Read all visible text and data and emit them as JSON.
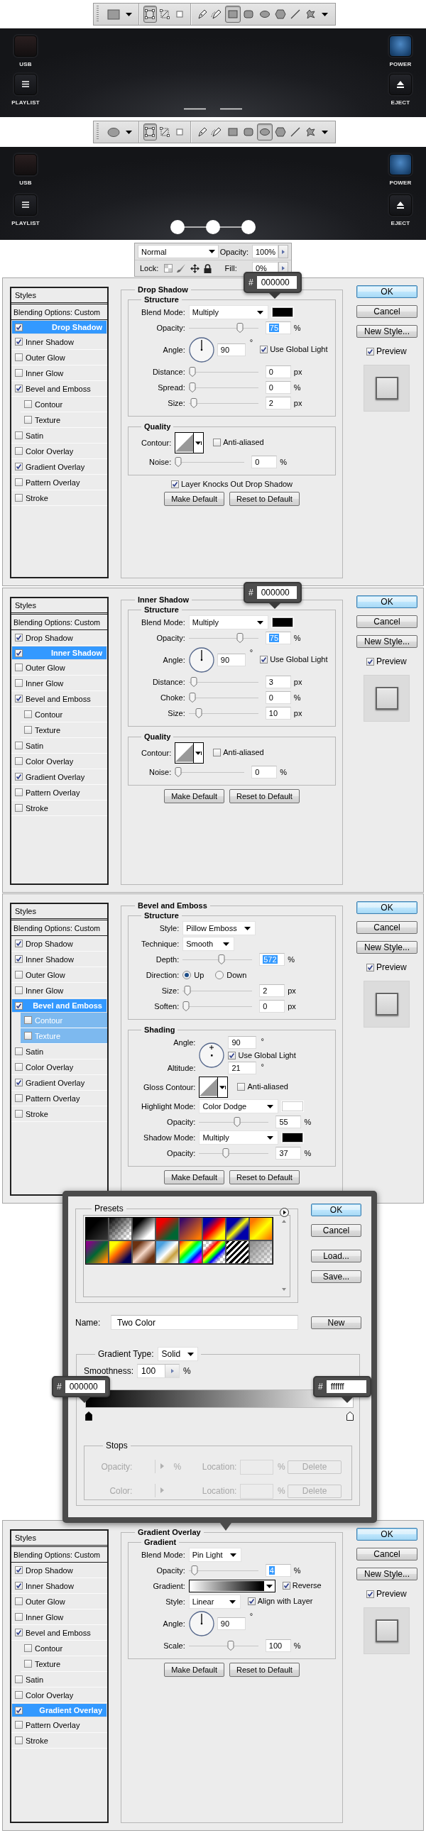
{
  "sections": [
    {
      "kind": "toolbar",
      "preset": {
        "kind": "rectangle"
      },
      "tools": [
        {
          "selected": true
        },
        {
          "selected": false
        },
        {
          "selected": false
        },
        {
          "selected": false
        },
        {
          "selected": false
        },
        {
          "selected": true
        },
        {
          "selected": false
        },
        {
          "selected": false
        },
        {
          "selected": false
        },
        {
          "selected": false
        },
        {
          "selected": false
        }
      ]
    },
    {
      "kind": "device_panel",
      "buttons": [
        {
          "kind": "usb",
          "label": "USB"
        },
        {
          "kind": "power",
          "label": "POWER"
        },
        {
          "kind": "playlist",
          "label": "PLAYLIST"
        },
        {
          "kind": "eject",
          "label": "EJECT"
        }
      ],
      "indicator": {
        "kind": "dashes"
      }
    },
    {
      "kind": "toolbar",
      "preset": {
        "kind": "ellipse"
      },
      "tools": [
        {
          "selected": true
        },
        {
          "selected": false
        },
        {
          "selected": false
        },
        {
          "selected": false
        },
        {
          "selected": false
        },
        {
          "selected": false
        },
        {
          "selected": false
        },
        {
          "selected": true
        },
        {
          "selected": false
        },
        {
          "selected": false
        },
        {
          "selected": false
        }
      ]
    },
    {
      "kind": "device_panel",
      "buttons": [
        {
          "kind": "usb",
          "label": "USB"
        },
        {
          "kind": "power",
          "label": "POWER"
        },
        {
          "kind": "playlist",
          "label": "PLAYLIST"
        },
        {
          "kind": "eject",
          "label": "EJECT"
        }
      ],
      "indicator": {
        "kind": "dots"
      }
    },
    {
      "kind": "layers_bar",
      "blend_mode": "Normal",
      "opacity_label": "Opacity:",
      "opacity": "100%",
      "lock_label": "Lock:",
      "fill_label": "Fill:",
      "fill": "0%"
    },
    {
      "kind": "layer_style",
      "panel_title": "Drop Shadow",
      "color_popup": {
        "prefix": "#",
        "value": "000000"
      },
      "styles_header": "Styles",
      "blending": "Blending Options: Custom",
      "styles": [
        {
          "label": "Drop Shadow",
          "checked": true,
          "selected": true
        },
        {
          "label": "Inner Shadow",
          "checked": true,
          "selected": false
        },
        {
          "label": "Outer Glow",
          "checked": false,
          "selected": false
        },
        {
          "label": "Inner Glow",
          "checked": false,
          "selected": false
        },
        {
          "label": "Bevel and Emboss",
          "checked": true,
          "selected": false,
          "children": [
            {
              "label": "Contour",
              "checked": false,
              "selected": false
            },
            {
              "label": "Texture",
              "checked": false,
              "selected": false
            }
          ]
        },
        {
          "label": "Satin",
          "checked": false,
          "selected": false
        },
        {
          "label": "Color Overlay",
          "checked": false,
          "selected": false
        },
        {
          "label": "Gradient Overlay",
          "checked": true,
          "selected": false
        },
        {
          "label": "Pattern Overlay",
          "checked": false,
          "selected": false
        },
        {
          "label": "Stroke",
          "checked": false,
          "selected": false
        }
      ],
      "groups": [
        {
          "title": "Structure",
          "rows": [
            {
              "kind": "select",
              "label": "Blend Mode:",
              "value": "Multiply",
              "color": "#000000"
            },
            {
              "kind": "slider",
              "label": "Opacity:",
              "level": 0.76,
              "value": "75",
              "unit": "%",
              "selected": true
            },
            {
              "kind": "angle",
              "label": "Angle:",
              "value": "90",
              "unit": "°",
              "check": {
                "label": "Use Global Light",
                "checked": true
              }
            },
            {
              "kind": "slider",
              "label": "Distance:",
              "level": 0,
              "value": "0",
              "unit": "px",
              "selected": false
            },
            {
              "kind": "slider",
              "label": "Spread:",
              "level": 0,
              "value": "0",
              "unit": "%",
              "selected": false
            },
            {
              "kind": "slider",
              "label": "Size:",
              "level": 0.02,
              "value": "2",
              "unit": "px",
              "selected": false
            }
          ]
        },
        {
          "title": "Quality",
          "rows": [
            {
              "kind": "contour",
              "label": "Contour:",
              "check": {
                "label": "Anti-aliased",
                "checked": false
              }
            },
            {
              "kind": "slider",
              "label": "Noise:",
              "level": 0,
              "value": "0",
              "unit": "%",
              "selected": false
            }
          ]
        }
      ],
      "options": [
        {
          "label": "Layer Knocks Out Drop Shadow",
          "checked": true
        }
      ],
      "footer_buttons": [
        "Make Default",
        "Reset to Default"
      ],
      "side_buttons": [
        {
          "label": "OK",
          "default": true
        },
        {
          "label": "Cancel",
          "default": false
        },
        {
          "label": "New Style...",
          "default": false
        }
      ],
      "preview": {
        "label": "Preview",
        "checked": true
      }
    },
    {
      "kind": "layer_style",
      "panel_title": "Inner Shadow",
      "color_popup": {
        "prefix": "#",
        "value": "000000"
      },
      "styles_header": "Styles",
      "blending": "Blending Options: Custom",
      "styles": [
        {
          "label": "Drop Shadow",
          "checked": true,
          "selected": false
        },
        {
          "label": "Inner Shadow",
          "checked": true,
          "selected": true
        },
        {
          "label": "Outer Glow",
          "checked": false,
          "selected": false
        },
        {
          "label": "Inner Glow",
          "checked": false,
          "selected": false
        },
        {
          "label": "Bevel and Emboss",
          "checked": true,
          "selected": false,
          "children": [
            {
              "label": "Contour",
              "checked": false,
              "selected": false
            },
            {
              "label": "Texture",
              "checked": false,
              "selected": false
            }
          ]
        },
        {
          "label": "Satin",
          "checked": false,
          "selected": false
        },
        {
          "label": "Color Overlay",
          "checked": false,
          "selected": false
        },
        {
          "label": "Gradient Overlay",
          "checked": true,
          "selected": false
        },
        {
          "label": "Pattern Overlay",
          "checked": false,
          "selected": false
        },
        {
          "label": "Stroke",
          "checked": false,
          "selected": false
        }
      ],
      "groups": [
        {
          "title": "Structure",
          "rows": [
            {
              "kind": "select",
              "label": "Blend Mode:",
              "value": "Multiply",
              "color": "#000000"
            },
            {
              "kind": "slider",
              "label": "Opacity:",
              "level": 0.76,
              "value": "75",
              "unit": "%",
              "selected": true
            },
            {
              "kind": "angle",
              "label": "Angle:",
              "value": "90",
              "unit": "°",
              "check": {
                "label": "Use Global Light",
                "checked": true
              }
            },
            {
              "kind": "slider",
              "label": "Distance:",
              "level": 0.03,
              "value": "3",
              "unit": "px",
              "selected": false
            },
            {
              "kind": "slider",
              "label": "Choke:",
              "level": 0,
              "value": "0",
              "unit": "%",
              "selected": false
            },
            {
              "kind": "slider",
              "label": "Size:",
              "level": 0.1,
              "value": "10",
              "unit": "px",
              "selected": false
            }
          ]
        },
        {
          "title": "Quality",
          "rows": [
            {
              "kind": "contour",
              "label": "Contour:",
              "check": {
                "label": "Anti-aliased",
                "checked": false
              }
            },
            {
              "kind": "slider",
              "label": "Noise:",
              "level": 0,
              "value": "0",
              "unit": "%",
              "selected": false
            }
          ]
        }
      ],
      "footer_buttons": [
        "Make Default",
        "Reset to Default"
      ],
      "side_buttons": [
        {
          "label": "OK",
          "default": true
        },
        {
          "label": "Cancel",
          "default": false
        },
        {
          "label": "New Style...",
          "default": false
        }
      ],
      "preview": {
        "label": "Preview",
        "checked": true
      }
    },
    {
      "kind": "layer_style",
      "panel_title": "Bevel and Emboss",
      "styles_header": "Styles",
      "blending": "Blending Options: Custom",
      "styles": [
        {
          "label": "Drop Shadow",
          "checked": true,
          "selected": false
        },
        {
          "label": "Inner Shadow",
          "checked": true,
          "selected": false
        },
        {
          "label": "Outer Glow",
          "checked": false,
          "selected": false
        },
        {
          "label": "Inner Glow",
          "checked": false,
          "selected": false
        },
        {
          "label": "Bevel and Emboss",
          "checked": true,
          "selected": true,
          "children": [
            {
              "label": "Contour",
              "checked": false,
              "selected": true
            },
            {
              "label": "Texture",
              "checked": false,
              "selected": true
            }
          ]
        },
        {
          "label": "Satin",
          "checked": false,
          "selected": false
        },
        {
          "label": "Color Overlay",
          "checked": false,
          "selected": false
        },
        {
          "label": "Gradient Overlay",
          "checked": true,
          "selected": false
        },
        {
          "label": "Pattern Overlay",
          "checked": false,
          "selected": false
        },
        {
          "label": "Stroke",
          "checked": false,
          "selected": false
        }
      ],
      "groups": [
        {
          "title": "Structure",
          "rows": [
            {
              "kind": "select",
              "label": "Style:",
              "value": "Pillow Emboss"
            },
            {
              "kind": "select",
              "label": "Technique:",
              "value": "Smooth"
            },
            {
              "kind": "slider",
              "label": "Depth:",
              "level": 0.57,
              "value": "572",
              "unit": "%",
              "selected": true
            },
            {
              "kind": "radio",
              "label": "Direction:",
              "options": [
                {
                  "label": "Up",
                  "selected": true
                },
                {
                  "label": "Down",
                  "selected": false
                }
              ]
            },
            {
              "kind": "slider",
              "label": "Size:",
              "level": 0.02,
              "value": "2",
              "unit": "px",
              "selected": false
            },
            {
              "kind": "slider",
              "label": "Soften:",
              "level": 0,
              "value": "0",
              "unit": "px",
              "selected": false
            }
          ]
        },
        {
          "title": "Shading",
          "rows": [
            {
              "kind": "shading_angle",
              "label": "Angle:",
              "value": "90",
              "unit": "°",
              "check": {
                "label": "Use Global Light",
                "checked": true
              },
              "altitude_label": "Altitude:",
              "altitude": "21",
              "altitude_unit": "°"
            },
            {
              "kind": "contour",
              "label": "Gloss Contour:",
              "check": {
                "label": "Anti-aliased",
                "checked": false
              }
            },
            {
              "kind": "select",
              "label": "Highlight Mode:",
              "value": "Color Dodge",
              "color": "#ffffff"
            },
            {
              "kind": "slider",
              "label": "Opacity:",
              "level": 0.55,
              "value": "55",
              "unit": "%",
              "selected": false
            },
            {
              "kind": "select",
              "label": "Shadow Mode:",
              "value": "Multiply",
              "color": "#000000"
            },
            {
              "kind": "slider",
              "label": "Opacity:",
              "level": 0.37,
              "value": "37",
              "unit": "%",
              "selected": false
            }
          ]
        }
      ],
      "footer_buttons": [
        "Make Default",
        "Reset to Default"
      ],
      "side_buttons": [
        {
          "label": "OK",
          "default": true
        },
        {
          "label": "Cancel",
          "default": false
        },
        {
          "label": "New Style...",
          "default": false
        }
      ],
      "preview": {
        "label": "Preview",
        "checked": true
      }
    },
    {
      "kind": "gradient_editor",
      "presets_title": "Presets",
      "buttons": [
        {
          "label": "OK",
          "default": true
        },
        {
          "label": "Cancel",
          "default": false
        },
        {
          "label": "Load...",
          "default": false
        },
        {
          "label": "Save...",
          "default": false
        }
      ],
      "name_label": "Name:",
      "name": "Two Color",
      "new_button": "New",
      "type_label": "Gradient Type:",
      "type": "Solid",
      "smoothness_label": "Smoothness:",
      "smoothness": "100",
      "smoothness_unit": "%",
      "stops": [
        {
          "prefix": "#",
          "value": "000000",
          "color": "#000000"
        },
        {
          "prefix": "#",
          "value": "ffffff",
          "color": "#ffffff"
        }
      ],
      "stops_title": "Stops",
      "stop_rows": [
        {
          "label": "Opacity:",
          "unit": "%",
          "location_label": "Location:",
          "location_unit": "%",
          "delete": "Delete",
          "disabled": true
        },
        {
          "label": "Color:",
          "unit": "",
          "location_label": "Location:",
          "location_unit": "%",
          "delete": "Delete",
          "disabled": true
        }
      ]
    },
    {
      "kind": "layer_style",
      "panel_title": "Gradient Overlay",
      "styles_header": "Styles",
      "blending": "Blending Options: Custom",
      "styles": [
        {
          "label": "Drop Shadow",
          "checked": true,
          "selected": false
        },
        {
          "label": "Inner Shadow",
          "checked": true,
          "selected": false
        },
        {
          "label": "Outer Glow",
          "checked": false,
          "selected": false
        },
        {
          "label": "Inner Glow",
          "checked": false,
          "selected": false
        },
        {
          "label": "Bevel and Emboss",
          "checked": true,
          "selected": false,
          "children": [
            {
              "label": "Contour",
              "checked": false,
              "selected": false
            },
            {
              "label": "Texture",
              "checked": false,
              "selected": false
            }
          ]
        },
        {
          "label": "Satin",
          "checked": false,
          "selected": false
        },
        {
          "label": "Color Overlay",
          "checked": false,
          "selected": false
        },
        {
          "label": "Gradient Overlay",
          "checked": true,
          "selected": true
        },
        {
          "label": "Pattern Overlay",
          "checked": false,
          "selected": false
        },
        {
          "label": "Stroke",
          "checked": false,
          "selected": false
        }
      ],
      "groups": [
        {
          "title": "Gradient",
          "rows": [
            {
              "kind": "select",
              "label": "Blend Mode:",
              "value": "Pin Light"
            },
            {
              "kind": "slider",
              "label": "Opacity:",
              "level": 0.04,
              "value": "4",
              "unit": "%",
              "selected": true
            },
            {
              "kind": "gradient",
              "label": "Gradient:",
              "check": {
                "label": "Reverse",
                "checked": true
              }
            },
            {
              "kind": "select",
              "label": "Style:",
              "value": "Linear",
              "check": {
                "label": "Align with Layer",
                "checked": true
              }
            },
            {
              "kind": "angle",
              "label": "Angle:",
              "value": "90",
              "unit": "°"
            },
            {
              "kind": "slider",
              "label": "Scale:",
              "level": 0.62,
              "value": "100",
              "unit": "%",
              "selected": false
            }
          ]
        }
      ],
      "footer_buttons": [
        "Make Default",
        "Reset to Default"
      ],
      "side_buttons": [
        {
          "label": "OK",
          "default": true
        },
        {
          "label": "Cancel",
          "default": false
        },
        {
          "label": "New Style...",
          "default": false
        }
      ],
      "preview": {
        "label": "Preview",
        "checked": true
      }
    }
  ]
}
